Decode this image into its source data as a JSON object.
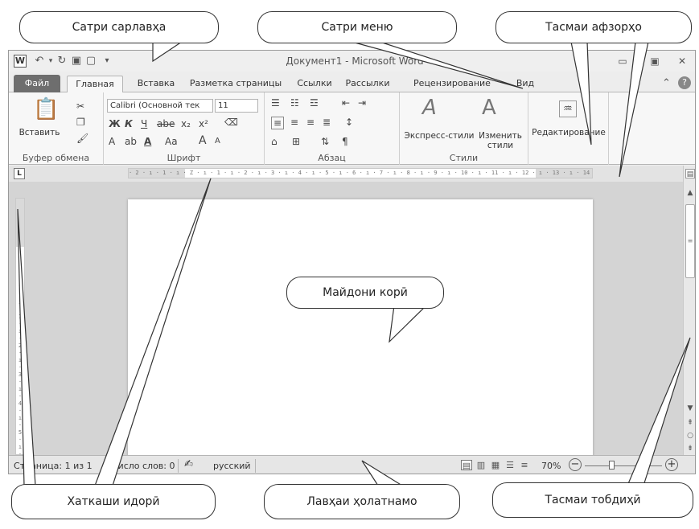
{
  "window": {
    "title": "Документ1 - Microsoft Word",
    "quick_access": {
      "save": "save-icon",
      "undo": "undo-icon",
      "redo": "redo-icon",
      "new": "new-document-icon"
    }
  },
  "tabs": [
    "Файл",
    "Главная",
    "Вставка",
    "Разметка страницы",
    "Ссылки",
    "Рассылки",
    "Рецензирование",
    "Вид"
  ],
  "active_tab": "Главная",
  "ribbon": {
    "clipboard": {
      "paste_label": "Вставить",
      "group_label": "Буфер обмена"
    },
    "font": {
      "font_name": "Calibri (Основной тек",
      "font_size": "11",
      "bold": "Ж",
      "italic": "К",
      "underline": "Ч",
      "strike": "abe",
      "subscript": "x₂",
      "superscript": "x²",
      "change_case": "Aa",
      "grow": "A",
      "shrink": "A",
      "group_label": "Шрифт"
    },
    "paragraph": {
      "pilcrow": "¶",
      "group_label": "Абзац"
    },
    "styles": {
      "quick_styles": "Экспресс-стили",
      "change_styles_1": "Изменить",
      "change_styles_2": "стили",
      "group_label": "Стили"
    },
    "editing": {
      "label": "Редактирование"
    }
  },
  "ruler": {
    "marks": "· 2 · ı · 1 · ı · Z · ı · 1 · ı · 2 · ı · 3 · ı · 4 · ı · 5 · ı · 6 · ı · 7 · ı · 8 · ı · 9 · ı · 10 · ı · 11 · ı · 12 · ı · 13 · ı · 14 · ı · 15 · ı · ∆ · ı · 17 · ı · 18 ·",
    "vmarks": "·2·ı·1·ı·1·ı·2·ı·3·ı·4·ı·5·ı·6·ı·7·ı·8·"
  },
  "statusbar": {
    "page": "Страница: 1 из 1",
    "words": "Число слов: 0",
    "language": "русский",
    "zoom": "70%",
    "zoom_out": "−",
    "zoom_in": "+"
  },
  "callouts": {
    "title_bar": "Сатри сарлавҳа",
    "menu_bar": "Сатри меню",
    "toolbars": "Тасмаи афзорҳо",
    "work_area": "Майдони корӣ",
    "ruler": "Хаткаши идорӣ",
    "status_bar": "Лавҳаи ҳолатнамо",
    "scroll_bar": "Тасмаи тобдиҳӣ"
  },
  "colors": {
    "file_tab": "#6e6e6e",
    "window_bg": "#ededed",
    "workspace": "#d4d4d4"
  }
}
